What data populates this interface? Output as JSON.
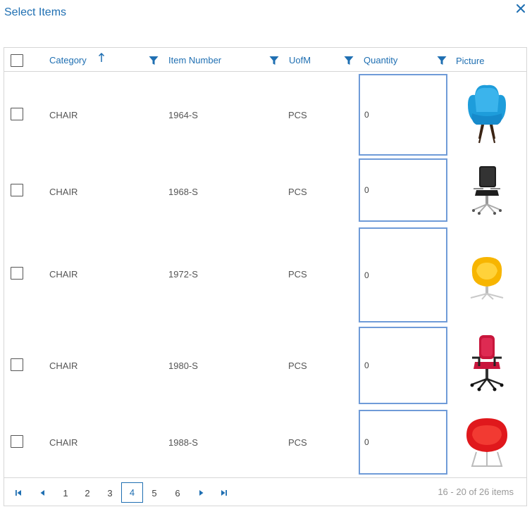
{
  "dialog": {
    "title": "Select Items",
    "close_icon": "close-icon"
  },
  "colors": {
    "accent": "#1f6fb2",
    "input_border": "#6f9bd8",
    "border": "#d6d6d6"
  },
  "columns": {
    "category": "Category",
    "item_number": "Item Number",
    "uofm": "UofM",
    "quantity": "Quantity",
    "picture": "Picture"
  },
  "rows": [
    {
      "category": "CHAIR",
      "item_number": "1964-S",
      "uofm": "PCS",
      "quantity": "0",
      "picture": "blue-wingback-chair"
    },
    {
      "category": "CHAIR",
      "item_number": "1968-S",
      "uofm": "PCS",
      "quantity": "0",
      "picture": "black-office-chair"
    },
    {
      "category": "CHAIR",
      "item_number": "1972-S",
      "uofm": "PCS",
      "quantity": "0",
      "picture": "yellow-egg-chair"
    },
    {
      "category": "CHAIR",
      "item_number": "1980-S",
      "uofm": "PCS",
      "quantity": "0",
      "picture": "red-office-chair"
    },
    {
      "category": "CHAIR",
      "item_number": "1988-S",
      "uofm": "PCS",
      "quantity": "0",
      "picture": "red-tub-chair"
    }
  ],
  "pager": {
    "pages": [
      "1",
      "2",
      "3",
      "4",
      "5",
      "6"
    ],
    "current_page": "4",
    "info": "16 - 20 of 26 items"
  }
}
